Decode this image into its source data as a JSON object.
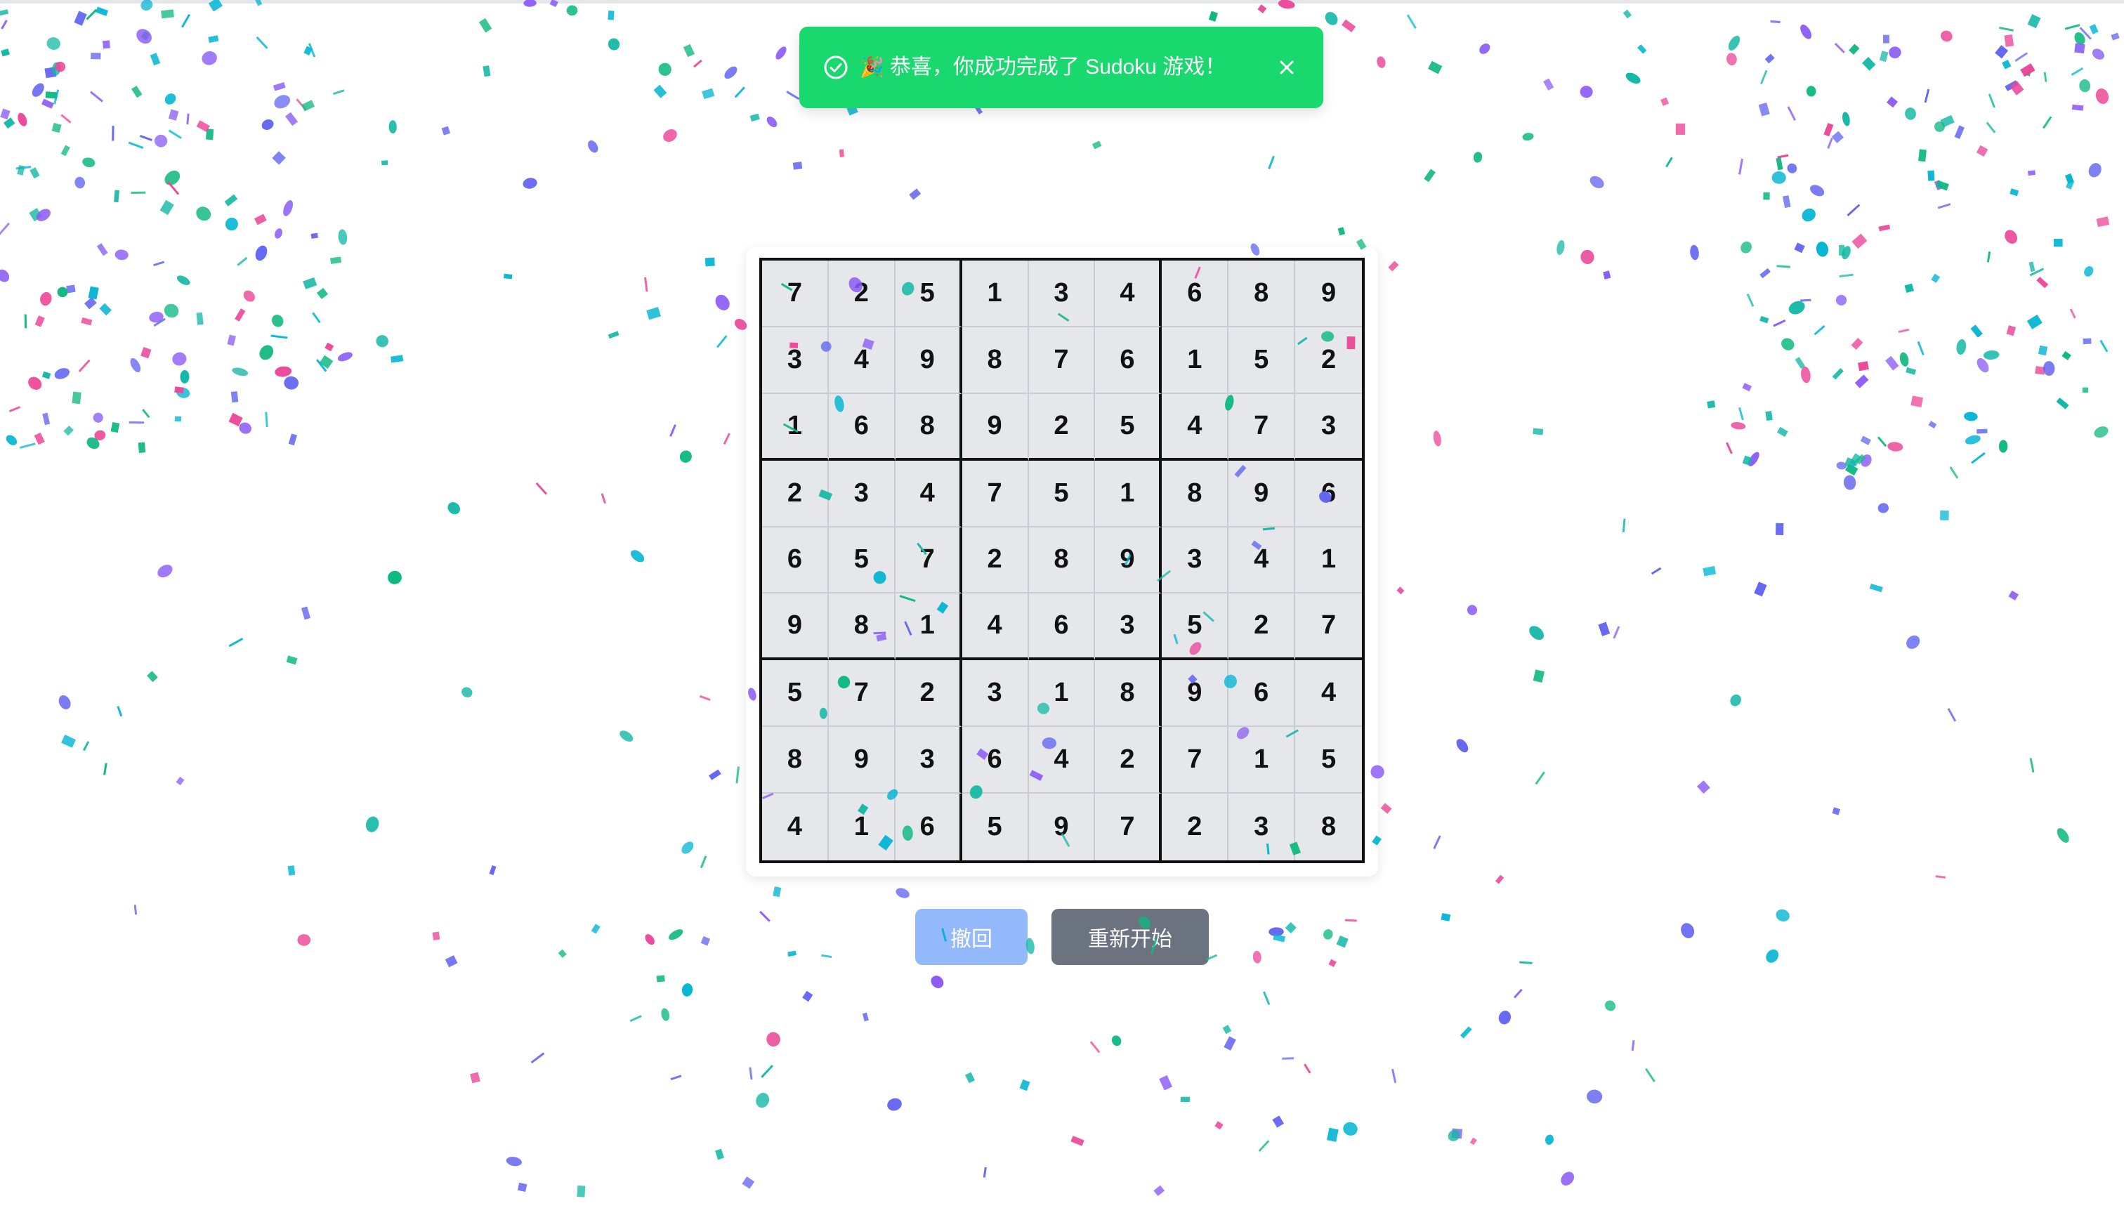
{
  "toast": {
    "message": "恭喜，你成功完成了 Sudoku 游戏！",
    "icon": "check-circle-icon",
    "emoji": "🎉",
    "close_icon": "close-icon",
    "color": "#19d86e"
  },
  "board": {
    "rows": [
      [
        "7",
        "2",
        "5",
        "1",
        "3",
        "4",
        "6",
        "8",
        "9"
      ],
      [
        "3",
        "4",
        "9",
        "8",
        "7",
        "6",
        "1",
        "5",
        "2"
      ],
      [
        "1",
        "6",
        "8",
        "9",
        "2",
        "5",
        "4",
        "7",
        "3"
      ],
      [
        "2",
        "3",
        "4",
        "7",
        "5",
        "1",
        "8",
        "9",
        "6"
      ],
      [
        "6",
        "5",
        "7",
        "2",
        "8",
        "9",
        "3",
        "4",
        "1"
      ],
      [
        "9",
        "8",
        "1",
        "4",
        "6",
        "3",
        "5",
        "2",
        "7"
      ],
      [
        "5",
        "7",
        "2",
        "3",
        "1",
        "8",
        "9",
        "6",
        "4"
      ],
      [
        "8",
        "9",
        "3",
        "6",
        "4",
        "2",
        "7",
        "1",
        "5"
      ],
      [
        "4",
        "1",
        "6",
        "5",
        "9",
        "7",
        "2",
        "3",
        "8"
      ]
    ]
  },
  "controls": {
    "undo_label": "撤回",
    "undo_disabled": true,
    "restart_label": "重新开始"
  },
  "confetti": {
    "colors": [
      "#8b5cf6",
      "#ec4899",
      "#14b8a6",
      "#06b6d4",
      "#10b981",
      "#6366f1"
    ]
  }
}
